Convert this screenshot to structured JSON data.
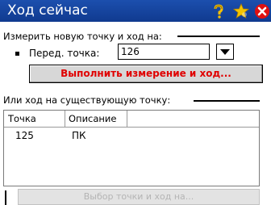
{
  "window": {
    "title": "Ход сейчас",
    "titlebar_color": "#1a4aa6"
  },
  "titlebar_icons": [
    "help-icon",
    "star-icon",
    "close-icon"
  ],
  "new_point_section": {
    "label": "Измерить новую точку и ход на:",
    "field_label": "Перед. точка:",
    "point_value": "126",
    "measure_button": "Выполнить измерение и ход...",
    "measure_button_text_color": "#e00000"
  },
  "existing_point_section": {
    "label": "Или ход на существующую точку:",
    "columns": [
      "Точка",
      "Описание"
    ],
    "rows": [
      {
        "point": "125",
        "description": "ПК"
      }
    ]
  },
  "bottom": {
    "select_button": "Выбор точки и ход на...",
    "select_button_enabled": false
  }
}
